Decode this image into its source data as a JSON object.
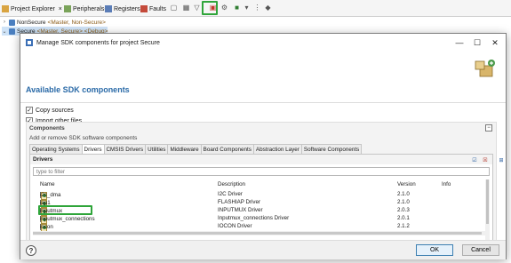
{
  "ide": {
    "tabs": [
      {
        "label": "Project Explorer",
        "close": "×"
      },
      {
        "label": "Peripherals+"
      },
      {
        "label": "Registers"
      },
      {
        "label": "Faults"
      }
    ],
    "tree": [
      {
        "name": "NonSecure",
        "suffix": "<Master, Non-Secure>"
      },
      {
        "name": "Secure",
        "suffix": "<Master, Secure> <Debug>"
      }
    ]
  },
  "dialog": {
    "title": "Manage SDK components for project Secure",
    "heading": "Available SDK components",
    "copy_sources": {
      "label": "Copy sources",
      "checked": true
    },
    "import_other_files": {
      "label": "Import other files",
      "checked": true
    },
    "components": {
      "title": "Components",
      "description": "Add or remove SDK software components",
      "tabs": [
        "Operating Systems",
        "Drivers",
        "CMSIS Drivers",
        "Utilities",
        "Middleware",
        "Board Components",
        "Abstraction Layer",
        "Software Components"
      ],
      "active_tab": "Drivers"
    },
    "drivers": {
      "title": "Drivers",
      "filter_placeholder": "type to filter",
      "columns": {
        "name": "Name",
        "description": "Description",
        "version": "Version",
        "info": "Info"
      },
      "rows": [
        {
          "name": "i2c_dma",
          "description": "I2C Driver",
          "version": "2.1.0",
          "checked": false
        },
        {
          "name": "iap1",
          "description": "FLASHIAP Driver",
          "version": "2.1.0",
          "checked": false
        },
        {
          "name": "inputmux",
          "description": "INPUTMUX Driver",
          "version": "2.0.3",
          "checked": true
        },
        {
          "name": "inputmux_connections",
          "description": "Inputmux_connections Driver",
          "version": "2.0.1",
          "checked": false
        },
        {
          "name": "iocon",
          "description": "IOCON Driver",
          "version": "2.1.2",
          "checked": false
        }
      ]
    },
    "buttons": {
      "ok": "OK",
      "cancel": "Cancel",
      "help": "?"
    },
    "window_controls": {
      "minimize": "—",
      "maximize": "☐",
      "close": "✕"
    }
  },
  "colors": {
    "highlight": "#2fa53a",
    "heading": "#2a6aa7"
  },
  "icons": [
    "project-icon",
    "peripherals-icon",
    "registers-icon",
    "faults-icon",
    "manage-sdk-components-icon",
    "filter-icon",
    "help-icon",
    "wizard-banner-icon",
    "check-all-icon",
    "uncheck-all-icon",
    "expand-icon",
    "collapse-icon"
  ]
}
